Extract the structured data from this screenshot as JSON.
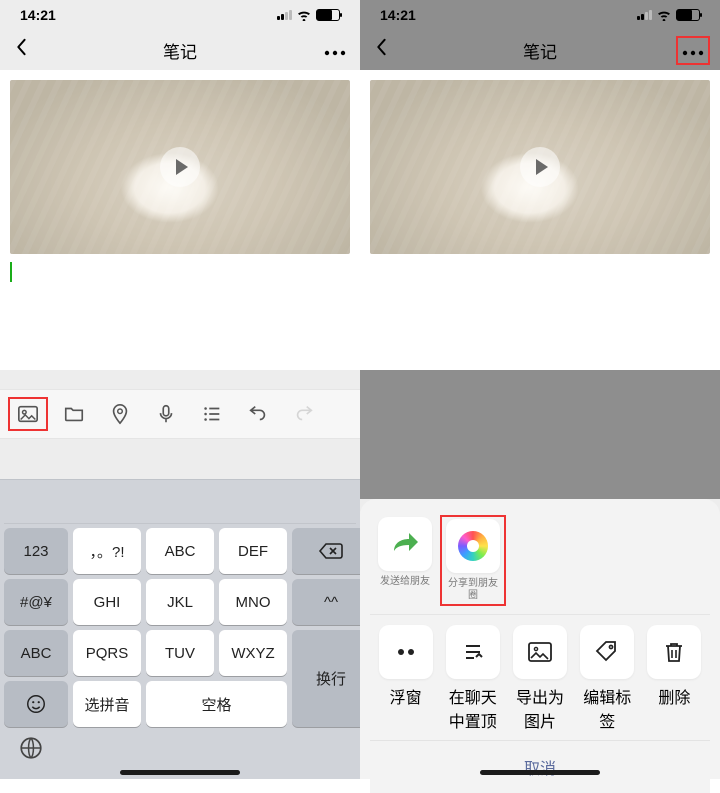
{
  "status": {
    "time": "14:21"
  },
  "nav": {
    "title": "笔记"
  },
  "left": {
    "toolbar_icons": [
      "photo",
      "folder",
      "location",
      "mic",
      "list",
      "undo",
      "redo"
    ],
    "keyboard": {
      "r1": [
        "123",
        "，。?!",
        "ABC",
        "DEF",
        "⌫"
      ],
      "r2": [
        "#@¥",
        "GHI",
        "JKL",
        "MNO",
        "^^"
      ],
      "r3": [
        "ABC",
        "PQRS",
        "TUV",
        "WXYZ"
      ],
      "r3tail": "换行",
      "r4": [
        "😊",
        "选拼音",
        "空格"
      ]
    }
  },
  "right": {
    "share": {
      "send": "发送给朋友",
      "moments": "分享到朋友圈"
    },
    "actions": {
      "float": "浮窗",
      "pin": "在聊天中置顶",
      "export": "导出为图片",
      "tag": "编辑标签",
      "delete": "删除"
    },
    "cancel": "取消"
  }
}
